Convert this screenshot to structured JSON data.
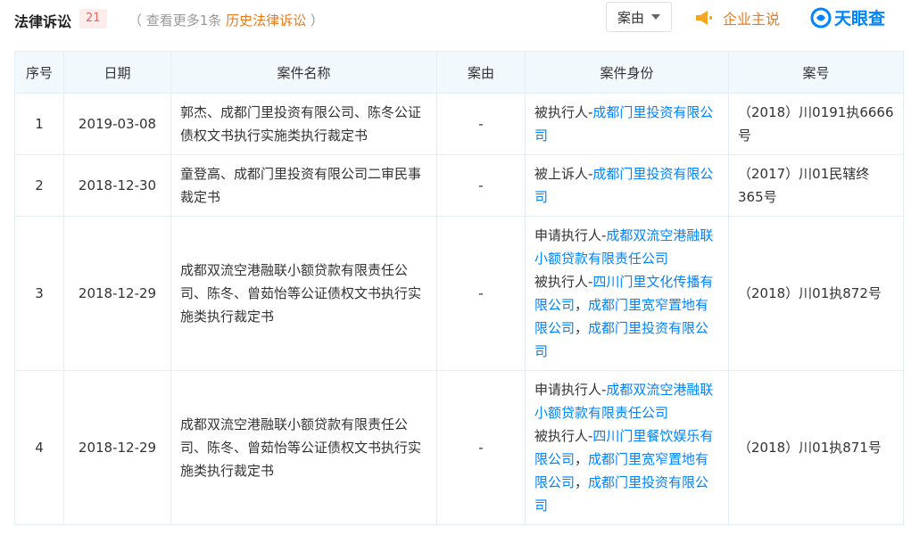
{
  "header": {
    "title": "法律诉讼",
    "count": "21",
    "history_prefix": "（ 查看更多1条",
    "history_link": "历史法律诉讼",
    "history_suffix": "）",
    "filter_label": "案由",
    "speak_label": "企业主说",
    "logo_text": "天眼查"
  },
  "colors": {
    "accent": "#0084ff",
    "orange": "#ef7a1e",
    "header_bg": "#f2f9fc",
    "badge_bg": "#fdecec"
  },
  "icons": {
    "filter": "chevron-down-icon",
    "speak": "megaphone-icon",
    "logo": "tianyancha-logo-icon"
  },
  "table": {
    "columns": [
      "序号",
      "日期",
      "案件名称",
      "案由",
      "案件身份",
      "案号"
    ],
    "rows": [
      {
        "index": "1",
        "date": "2019-03-08",
        "name": "郭杰、成都门里投资有限公司、陈冬公证债权文书执行实施类执行裁定书",
        "reason": "-",
        "roles": [
          {
            "role": "被执行人-",
            "parties": [
              {
                "name": "成都门里投资有限公司",
                "sep": ""
              }
            ]
          }
        ],
        "case_no": "（2018）川0191执6666号"
      },
      {
        "index": "2",
        "date": "2018-12-30",
        "name": "童登高、成都门里投资有限公司二审民事裁定书",
        "reason": "-",
        "roles": [
          {
            "role": "被上诉人-",
            "parties": [
              {
                "name": "成都门里投资有限公司",
                "sep": ""
              }
            ]
          }
        ],
        "case_no": "（2017）川01民辖终365号"
      },
      {
        "index": "3",
        "date": "2018-12-29",
        "name": "成都双流空港融联小额贷款有限责任公司、陈冬、曾茹怡等公证债权文书执行实施类执行裁定书",
        "reason": "-",
        "roles": [
          {
            "role": "申请执行人-",
            "parties": [
              {
                "name": "成都双流空港融联小额贷款有限责任公司",
                "sep": ""
              }
            ]
          },
          {
            "role": "被执行人-",
            "parties": [
              {
                "name": "四川门里文化传播有限公司",
                "sep": "，"
              },
              {
                "name": "成都门里宽窄置地有限公司",
                "sep": "，"
              },
              {
                "name": "成都门里投资有限公司",
                "sep": ""
              }
            ]
          }
        ],
        "case_no": "（2018）川01执872号"
      },
      {
        "index": "4",
        "date": "2018-12-29",
        "name": "成都双流空港融联小额贷款有限责任公司、陈冬、曾茹怡等公证债权文书执行实施类执行裁定书",
        "reason": "-",
        "roles": [
          {
            "role": "申请执行人-",
            "parties": [
              {
                "name": "成都双流空港融联小额贷款有限责任公司",
                "sep": ""
              }
            ]
          },
          {
            "role": "被执行人-",
            "parties": [
              {
                "name": "四川门里餐饮娱乐有限公司",
                "sep": "，"
              },
              {
                "name": "成都门里宽窄置地有限公司",
                "sep": "，"
              },
              {
                "name": "成都门里投资有限公司",
                "sep": ""
              }
            ]
          }
        ],
        "case_no": "（2018）川01执871号"
      }
    ]
  }
}
